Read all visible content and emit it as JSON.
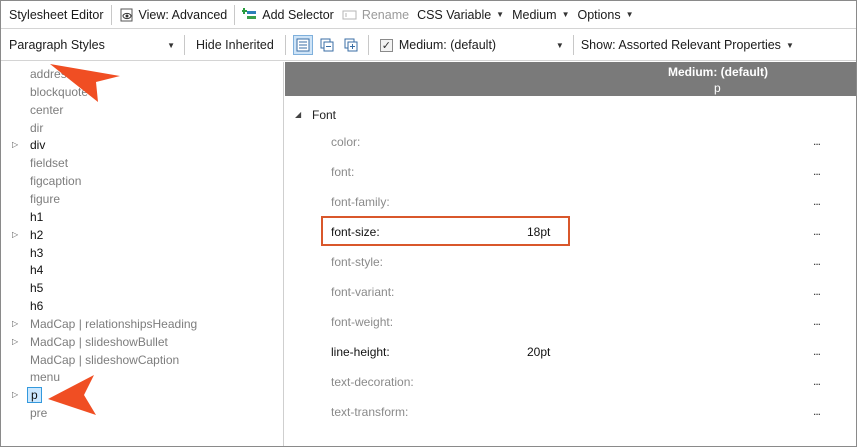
{
  "toolbar": {
    "title": "Stylesheet Editor",
    "view_label": "View: Advanced",
    "add_selector_label": "Add Selector",
    "rename_label": "Rename",
    "css_variable_label": "CSS Variable",
    "medium_label": "Medium",
    "options_label": "Options"
  },
  "filterbar": {
    "style_type": "Paragraph Styles",
    "hide_inherited_label": "Hide Inherited",
    "medium_checkbox_checked": true,
    "medium_select": "Medium: (default)",
    "show_select": "Show: Assorted Relevant Properties"
  },
  "tree": {
    "items": [
      {
        "label": "address",
        "expandable": false,
        "muted": true
      },
      {
        "label": "blockquote",
        "expandable": false,
        "muted": true
      },
      {
        "label": "center",
        "expandable": false,
        "muted": true
      },
      {
        "label": "dir",
        "expandable": false,
        "muted": true
      },
      {
        "label": "div",
        "expandable": true,
        "muted": false
      },
      {
        "label": "fieldset",
        "expandable": false,
        "muted": true
      },
      {
        "label": "figcaption",
        "expandable": false,
        "muted": true
      },
      {
        "label": "figure",
        "expandable": false,
        "muted": true
      },
      {
        "label": "h1",
        "expandable": false,
        "muted": false
      },
      {
        "label": "h2",
        "expandable": true,
        "muted": false
      },
      {
        "label": "h3",
        "expandable": false,
        "muted": false
      },
      {
        "label": "h4",
        "expandable": false,
        "muted": false
      },
      {
        "label": "h5",
        "expandable": false,
        "muted": false
      },
      {
        "label": "h6",
        "expandable": false,
        "muted": false
      },
      {
        "label": "MadCap | relationshipsHeading",
        "expandable": true,
        "muted": true
      },
      {
        "label": "MadCap | slideshowBullet",
        "expandable": true,
        "muted": true
      },
      {
        "label": "MadCap | slideshowCaption",
        "expandable": false,
        "muted": true
      },
      {
        "label": "menu",
        "expandable": false,
        "muted": true
      },
      {
        "label": "p",
        "expandable": true,
        "muted": false,
        "selected": true
      },
      {
        "label": "pre",
        "expandable": false,
        "muted": true
      }
    ]
  },
  "grid": {
    "header_medium": "Medium: (default)",
    "header_selector": "p",
    "group_label": "Font",
    "more_label": "...",
    "properties": [
      {
        "name": "color:",
        "value": "",
        "muted": true
      },
      {
        "name": "font:",
        "value": "",
        "muted": true
      },
      {
        "name": "font-family:",
        "value": "",
        "muted": true
      },
      {
        "name": "font-size:",
        "value": "18pt",
        "muted": false,
        "highlighted": true
      },
      {
        "name": "font-style:",
        "value": "",
        "muted": true
      },
      {
        "name": "font-variant:",
        "value": "",
        "muted": true
      },
      {
        "name": "font-weight:",
        "value": "",
        "muted": true
      },
      {
        "name": "line-height:",
        "value": "20pt",
        "muted": false
      },
      {
        "name": "text-decoration:",
        "value": "",
        "muted": true
      },
      {
        "name": "text-transform:",
        "value": "",
        "muted": true
      }
    ]
  },
  "colors": {
    "callout": "#f04e23",
    "highlight_box": "#d9572b",
    "grid_header": "#7a7a7a",
    "selection": "#cce8ff"
  }
}
